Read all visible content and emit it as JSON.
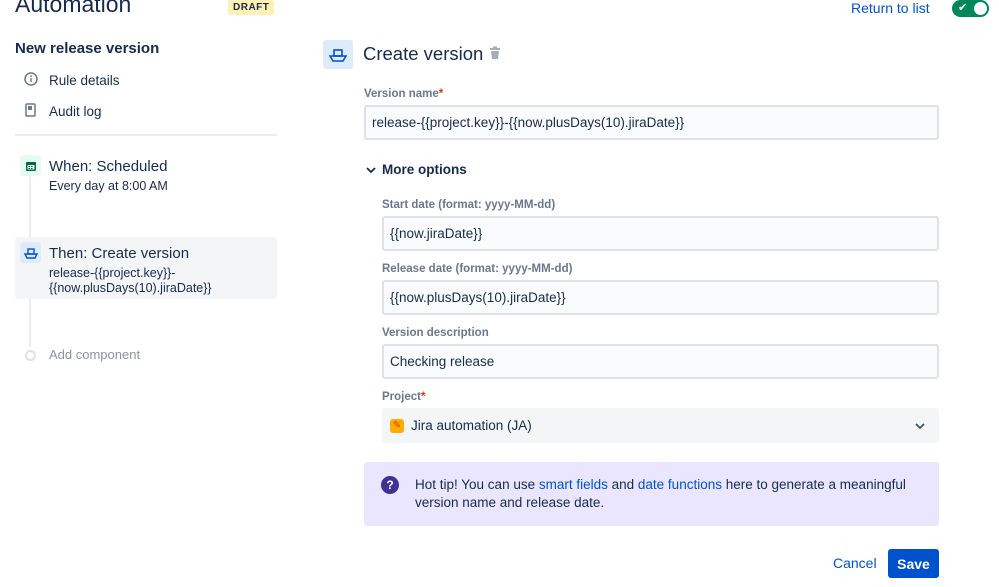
{
  "header": {
    "title": "Automation",
    "badge": "DRAFT",
    "return_link": "Return to list",
    "toggle_on": true
  },
  "sidebar": {
    "rule_name": "New release version",
    "nav": [
      {
        "label": "Rule details",
        "icon": "info-icon"
      },
      {
        "label": "Audit log",
        "icon": "document-icon"
      }
    ],
    "steps": [
      {
        "title": "When: Scheduled",
        "subtitle": "Every day at 8:00 AM",
        "icon": "calendar-icon"
      },
      {
        "title": "Then: Create version",
        "subtitle_line1": "release-{{project.key}}-",
        "subtitle_line2": "{{now.plusDays(10).jiraDate}}",
        "icon": "ship-icon"
      }
    ],
    "add_component": "Add component"
  },
  "main": {
    "title": "Create version",
    "version_name": {
      "label": "Version name",
      "value": "release-{{project.key}}-{{now.plusDays(10).jiraDate}}"
    },
    "more_options": "More options",
    "start_date": {
      "label": "Start date (format: yyyy-MM-dd)",
      "value": "{{now.jiraDate}}"
    },
    "release_date": {
      "label": "Release date (format: yyyy-MM-dd)",
      "value": "{{now.plusDays(10).jiraDate}}"
    },
    "description": {
      "label": "Version description",
      "value": "Checking release"
    },
    "project": {
      "label": "Project",
      "value": "Jira automation (JA)"
    },
    "tip": {
      "part1": "Hot tip! You can use ",
      "link1": "smart fields",
      "part2": " and ",
      "link2": "date functions",
      "part3": " here to generate a meaningful version name and release date."
    },
    "cancel": "Cancel",
    "save": "Save"
  },
  "colors": {
    "primary": "#0052cc",
    "toggle": "#00875a",
    "tip_bg": "#eae6ff"
  }
}
